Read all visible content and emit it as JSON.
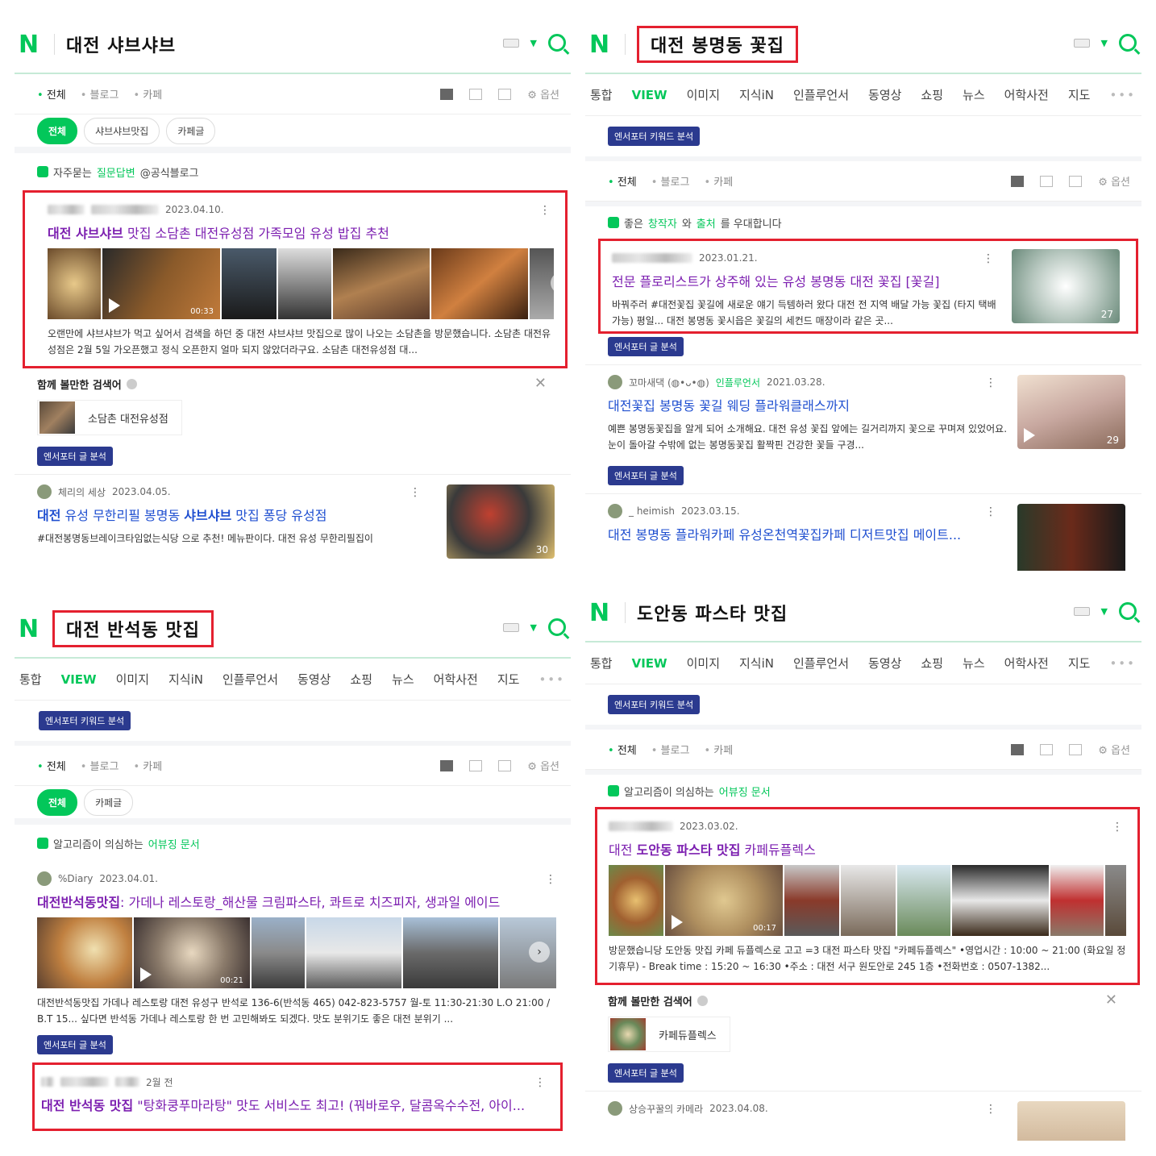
{
  "p1": {
    "query": "대전 샤브샤브",
    "filters": [
      "전체",
      "블로그",
      "카페"
    ],
    "option": "옵션",
    "chips": [
      "전체",
      "샤브샤브맛집",
      "카페글"
    ],
    "notice": {
      "pre": "자주묻는 ",
      "link": "질문답변",
      "post": " @공식블로그"
    },
    "post": {
      "date": "2023.04.10.",
      "title_b1": "대전 샤브샤브",
      "title_r": " 맛집 소담촌 대전유성점 가족모임 유성 밥집 추천",
      "duration": "00:33",
      "desc": "오랜만에 샤브샤브가 먹고 싶어서 검색을 하던 중 대전 샤브샤브 맛집으로 많이 나오는 소담촌을 방문했습니다. 소담촌 대전유성점은 2월 5일 가오픈했고 정식 오픈한지 얼마 되지 않았더라구요. 소담촌 대전유성점 대..."
    },
    "related": {
      "title": "함께 볼만한 검색어",
      "item": "소담촌 대전유성점"
    },
    "badge_post": "엔서포터 글 분석",
    "post2": {
      "author": "체리의 세상",
      "date": "2023.04.05.",
      "title_b1": "대전",
      "title_m": " 유성 무한리필 봉명동 ",
      "title_b2": "샤브샤브",
      "title_r": " 맛집 퐁당 유성점",
      "desc": "#대전봉명동브레이크타임없는식당 으로 추천! 메뉴판이다. 대전 유성 무한리필집이",
      "count": "30"
    }
  },
  "p2": {
    "query": "대전 봉명동 꽃집",
    "tabs": [
      "통합",
      "VIEW",
      "이미지",
      "지식iN",
      "인플루언서",
      "동영상",
      "쇼핑",
      "뉴스",
      "어학사전",
      "지도"
    ],
    "badge_kw": "엔서포터 키워드 분석",
    "filters": [
      "전체",
      "블로그",
      "카페"
    ],
    "option": "옵션",
    "notice": {
      "pre": "좋은 ",
      "l1": "창작자",
      "mid": "와 ",
      "l2": "출처",
      "post": "를 우대합니다"
    },
    "post1": {
      "date": "2023.01.21.",
      "title": "전문 플로리스트가 상주해 있는 유성 봉명동 대전 꽃집 [꽃길]",
      "desc": "바꿔주러 #대전꽃집 꽃길에 새로운 얘기 득템하러 왔다 대전 전 지역 배달 가능 꽃집 (타지 택배 가능) 평일... 대전 봉명동 꽃시읍은 꽃길의 세컨드 매장이라 같은 곳...",
      "count": "27"
    },
    "badge_post": "엔서포터 글 분석",
    "post2": {
      "author": "꼬마새댁 (◍•ᴗ•◍)",
      "tag": "인플루언서",
      "date": "2021.03.28.",
      "title": "대전꽃집 봉명동 꽃길 웨딩 플라워클래스까지",
      "desc": "예쁜 봉명동꽃집을 알게 되어 소개해요. 대전 유성 꽃집 앞에는 길거리까지 꽃으로 꾸며져 있었어요. 눈이 돌아갈 수밖에 없는 봉명동꽃집 활짝핀 건강한 꽃들 구경...",
      "count": "29"
    },
    "post3": {
      "author": "_ heimish",
      "date": "2023.03.15.",
      "title": "대전 봉명동 플라워카페 유성온천역꽃집카페 디저트맛집 메이트..."
    }
  },
  "p3": {
    "query": "대전 반석동 맛집",
    "tabs": [
      "통합",
      "VIEW",
      "이미지",
      "지식iN",
      "인플루언서",
      "동영상",
      "쇼핑",
      "뉴스",
      "어학사전",
      "지도"
    ],
    "badge_kw": "엔서포터 키워드 분석",
    "filters": [
      "전체",
      "블로그",
      "카페"
    ],
    "option": "옵션",
    "chips": [
      "전체",
      "카페글"
    ],
    "notice": {
      "pre": "알고리즘이 의심하는 ",
      "link": "어뷰징 문서"
    },
    "post1": {
      "author": "%Diary",
      "date": "2023.04.01.",
      "title_b": "대전반석동맛집",
      "title_r": ": 가데나 레스토랑_해산물 크림파스타, 콰트로 치즈피자, 생과일 에이드",
      "duration": "00:21",
      "desc": "대전반석동맛집 가데나 레스토랑 대전 유성구 반석로 136-6(반석동 465) 042-823-5757 월-토 11:30-21:30 L.O 21:00 / B.T 15... 싶다면 반석동 가데나 레스토랑 한 번 고민해봐도 되겠다. 맛도 분위기도 좋은 대전 분위기 ..."
    },
    "badge_post": "엔서포터 글 분석",
    "post2": {
      "date": "2월 전",
      "title_b": "대전 반석동 맛집",
      "title_r": " \"탕화쿵푸마라탕\" 맛도 서비스도 최고! (꿔바로우, 달콤옥수수전, 아이..."
    }
  },
  "p4": {
    "query": "도안동 파스타 맛집",
    "tabs": [
      "통합",
      "VIEW",
      "이미지",
      "지식iN",
      "인플루언서",
      "동영상",
      "쇼핑",
      "뉴스",
      "어학사전",
      "지도"
    ],
    "badge_kw": "엔서포터 키워드 분석",
    "filters": [
      "전체",
      "블로그",
      "카페"
    ],
    "option": "옵션",
    "notice": {
      "pre": "알고리즘이 의심하는 ",
      "link": "어뷰징 문서"
    },
    "post1": {
      "date": "2023.03.02.",
      "title_m1": "대전 ",
      "title_b": "도안동 파스타 맛집",
      "title_r": " 카페듀플렉스",
      "duration": "00:17",
      "desc": "방문했습니당 도안동 맛집 카페 듀플렉스로 고고 =3 대전 파스타 맛집 \"카페듀플렉스\" •영업시간 : 10:00 ~ 21:00 (화요일 정기휴무) - Break time : 15:20 ~ 16:30 •주소 : 대전 서구 원도안로 245 1층 •전화번호 : 0507-1382..."
    },
    "related": {
      "title": "함께 볼만한 검색어",
      "item": "카페듀플렉스"
    },
    "badge_post": "엔서포터 글 분석",
    "post2": {
      "author": "상승꾸꿀의 카메라",
      "date": "2023.04.08."
    }
  },
  "logo": "N",
  "colors": {
    "naver_green": "#03c75a",
    "highlight_red": "#e4202f",
    "badge_navy": "#2b3a8f",
    "title_purple": "#7c1fb0",
    "title_blue": "#1f4fd0"
  }
}
